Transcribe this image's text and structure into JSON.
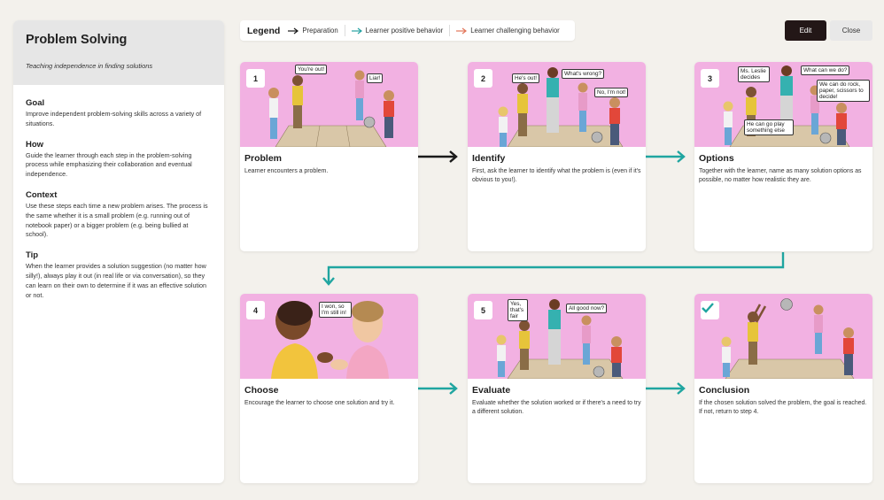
{
  "sidebar": {
    "title": "Problem Solving",
    "subtitle": "Teaching independence in finding solutions",
    "sections": [
      {
        "heading": "Goal",
        "text": "Improve independent problem-solving skills across a variety of situations."
      },
      {
        "heading": "How",
        "text": "Guide the learner through each step in the problem-solving process while emphasizing their collaboration and eventual independence."
      },
      {
        "heading": "Context",
        "text": "Use these steps each time a new problem arises. The process is the same whether it is a small problem (e.g. running out of notebook paper) or a bigger problem (e.g. being bullied at school)."
      },
      {
        "heading": "Tip",
        "text": "When the learner provides a solution suggestion (no matter how silly!), always play it out (in real life or via conversation), so they can learn on their own to determine if it was an effective solution or not."
      }
    ]
  },
  "legend": {
    "title": "Legend",
    "items": [
      {
        "label": "Preparation",
        "color": "#1a1a1a"
      },
      {
        "label": "Learner positive behavior",
        "color": "#27a3a3"
      },
      {
        "label": "Learner challenging behavior",
        "color": "#e2765a"
      }
    ]
  },
  "toolbar": {
    "edit_label": "Edit",
    "close_label": "Close"
  },
  "colors": {
    "illustration_bg": "#f2b1e2",
    "accent_teal": "#1fa5a0",
    "prep_black": "#1a1a1a"
  },
  "steps": [
    {
      "badge": "1",
      "title": "Problem",
      "desc": "Learner encounters a problem.",
      "bubbles": [
        "You're out!",
        "Liar!"
      ]
    },
    {
      "badge": "2",
      "title": "Identify",
      "desc": "First, ask the learner to identify what the problem is (even if it's obvious to you!).",
      "bubbles": [
        "He's out!",
        "What's wrong?",
        "No, I'm not!"
      ]
    },
    {
      "badge": "3",
      "title": "Options",
      "desc": "Together with the learner, name as many solution options as possible, no matter how realistic they are.",
      "bubbles": [
        "Ms. Leslie decides",
        "What can we do?",
        "We can do rock, paper, scissors to decide!",
        "He can go play something else"
      ]
    },
    {
      "badge": "4",
      "title": "Choose",
      "desc": "Encourage the learner to choose one solution and try it.",
      "bubbles": [
        "I won, so I'm still in!"
      ]
    },
    {
      "badge": "5",
      "title": "Evaluate",
      "desc": "Evaluate whether the solution worked or if there's a need to try a different solution.",
      "bubbles": [
        "Yes, that's fair",
        "All good now?"
      ]
    },
    {
      "badge": "check-icon",
      "title": "Conclusion",
      "desc": "If the chosen solution solved the problem, the goal is reached. If not, return to step 4.",
      "bubbles": []
    }
  ]
}
